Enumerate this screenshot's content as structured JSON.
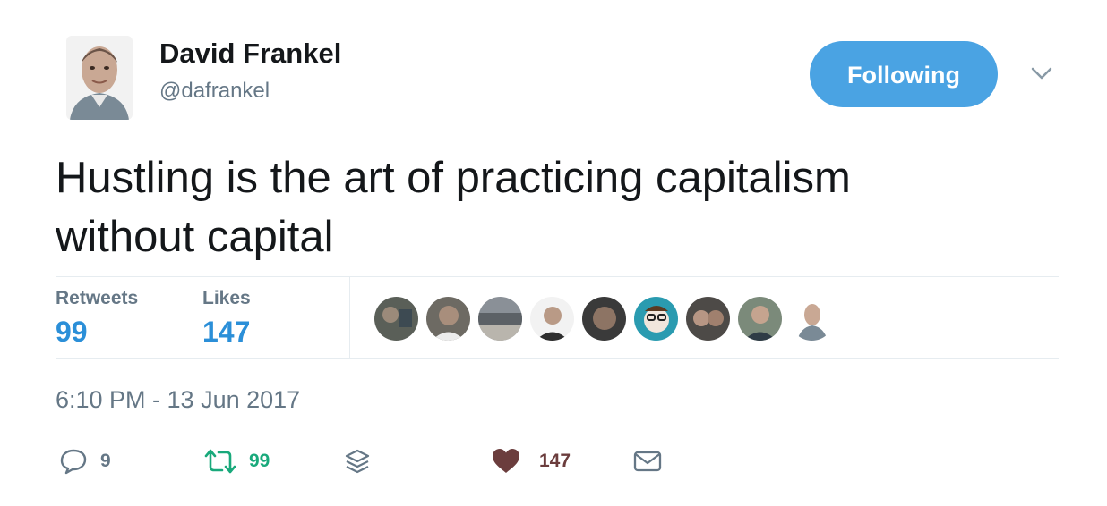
{
  "author": {
    "name": "David Frankel",
    "handle": "@dafrankel",
    "avatar_icon": "profile-photo"
  },
  "follow_button": {
    "label": "Following",
    "color": "#4aa3e3"
  },
  "menu_icon": "chevron-down-icon",
  "tweet": {
    "line1": "Hustling is the art of practicing capitalism",
    "line2": "without capital"
  },
  "stats": {
    "retweets_label": "Retweets",
    "retweets_value": "99",
    "likes_label": "Likes",
    "likes_value": "147"
  },
  "liker_avatars": [
    "liker-avatar-1",
    "liker-avatar-2",
    "liker-avatar-3",
    "liker-avatar-4",
    "liker-avatar-5",
    "liker-avatar-6",
    "liker-avatar-7",
    "liker-avatar-8",
    "liker-avatar-9"
  ],
  "timestamp": "6:10 PM - 13 Jun 2017",
  "actions": {
    "reply_count": "9",
    "retweet_count": "99",
    "like_count": "147",
    "colors": {
      "reply": "#657786",
      "retweet": "#19a97b",
      "like": "#6b3d3d"
    }
  }
}
